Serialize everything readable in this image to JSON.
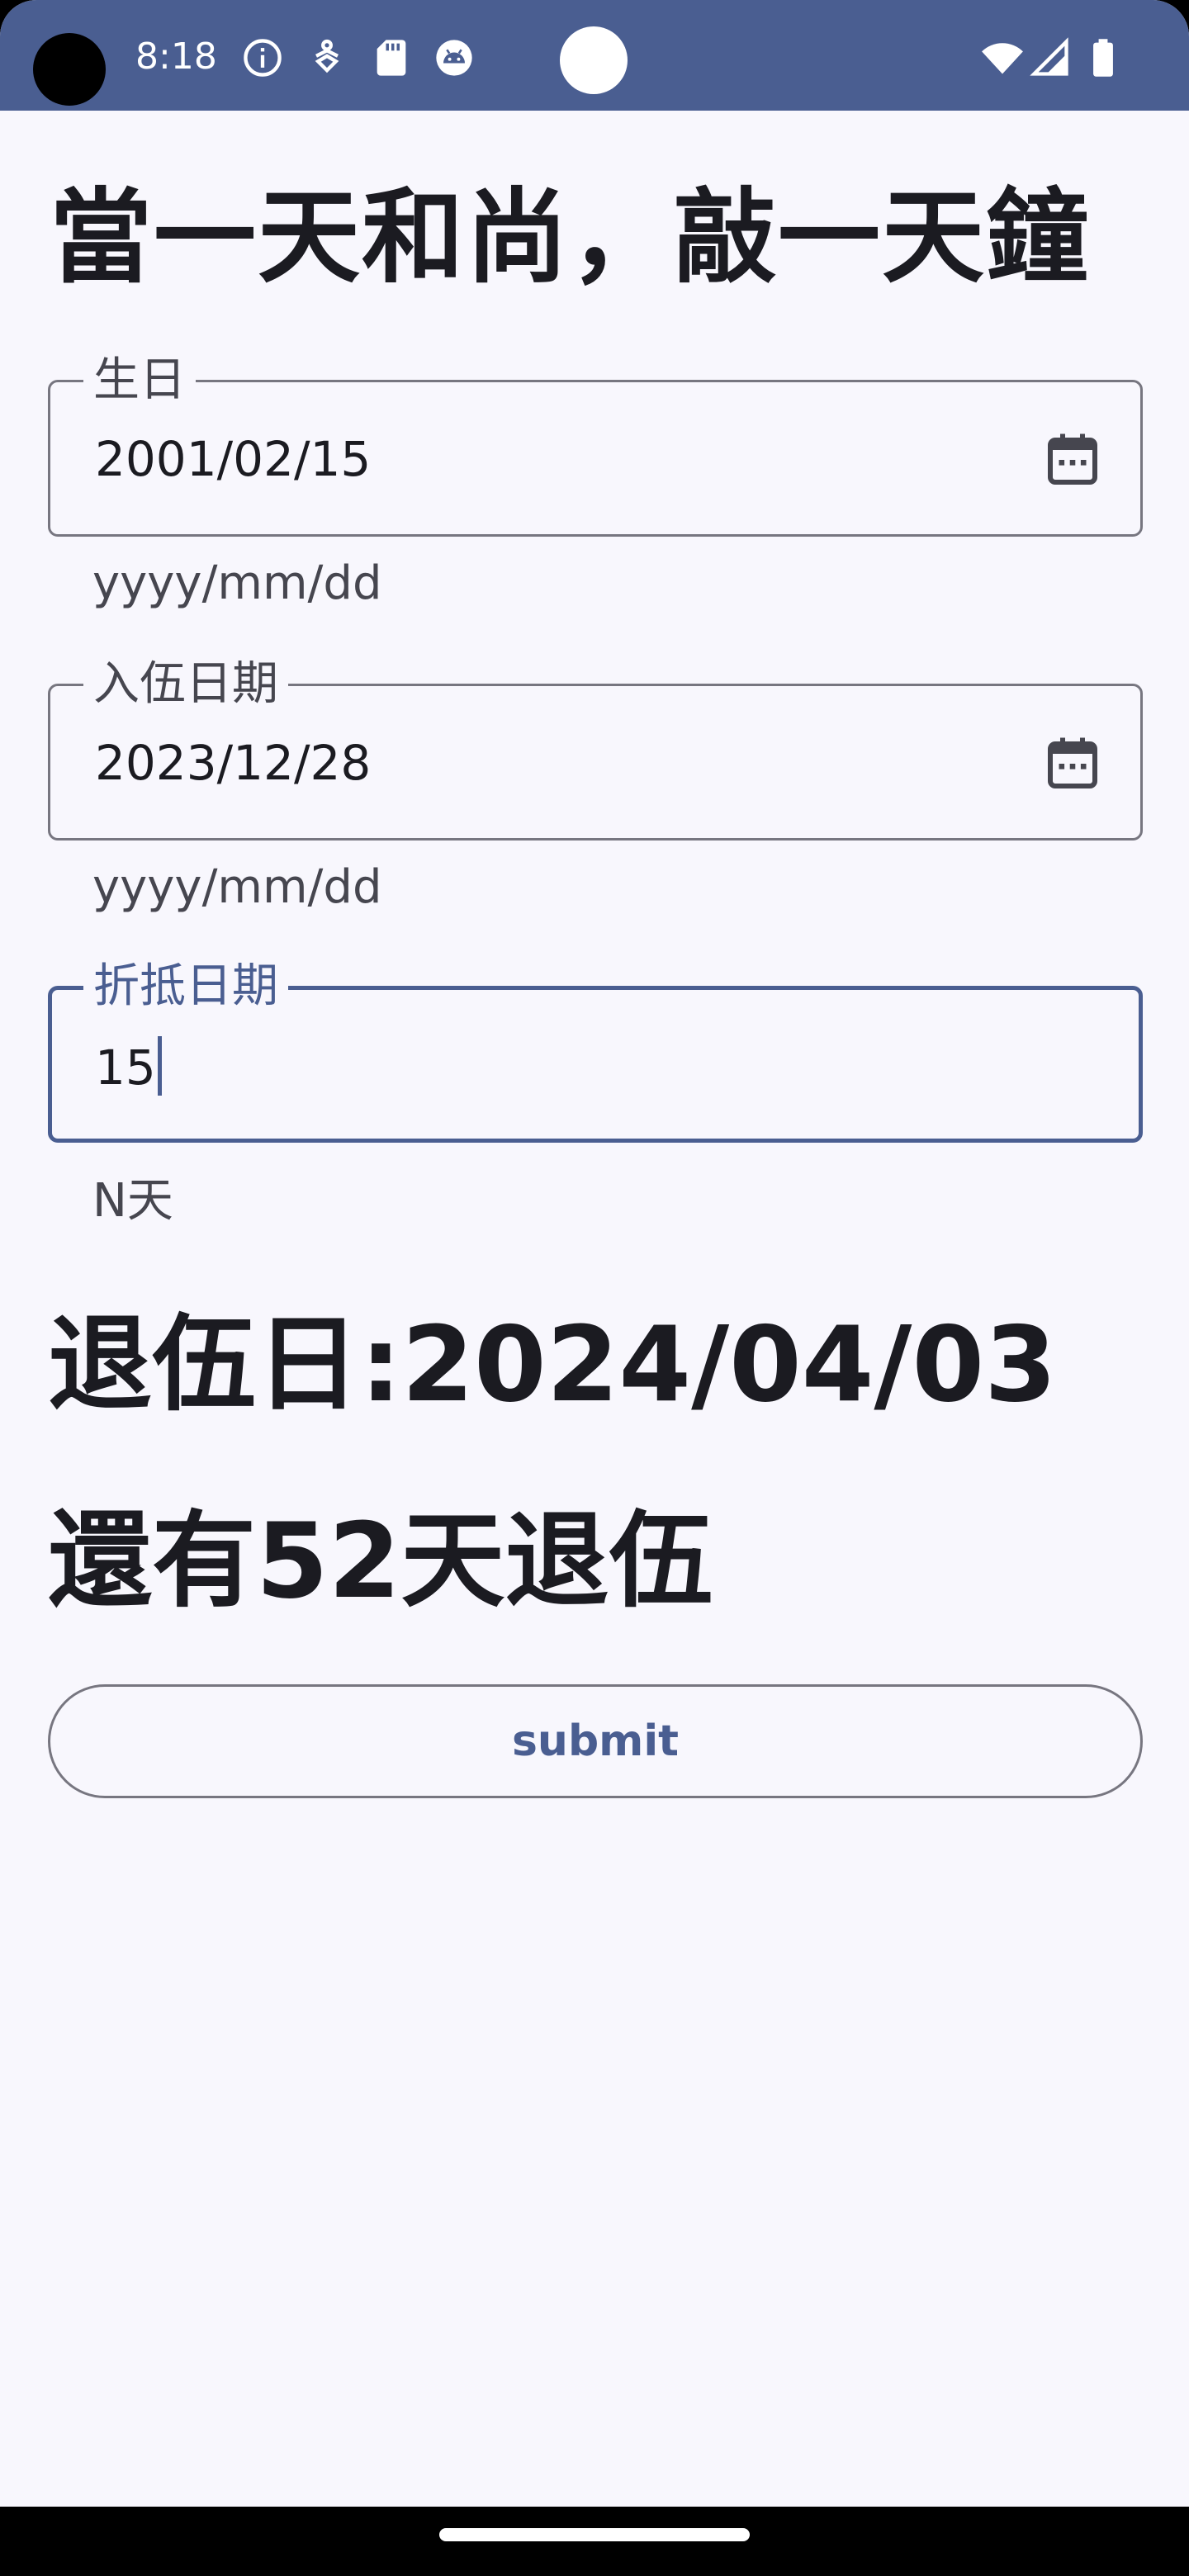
{
  "status_bar": {
    "time": "8:18",
    "icons": [
      "info-icon",
      "usb-debug-icon",
      "sd-card-icon",
      "android-icon",
      "wifi-icon",
      "signal-icon",
      "battery-icon"
    ],
    "background_color": "#4a5e91"
  },
  "page": {
    "title": "當一天和尚，敲一天鐘"
  },
  "fields": {
    "birthday": {
      "label": "生日",
      "value": "2001/02/15",
      "helper": "yyyy/mm/dd",
      "trailing_icon": "calendar-icon"
    },
    "enlist_date": {
      "label": "入伍日期",
      "value": "2023/12/28",
      "helper": "yyyy/mm/dd",
      "trailing_icon": "calendar-icon"
    },
    "deduction": {
      "label": "折抵日期",
      "value": "15",
      "helper": "N天",
      "focused": true
    }
  },
  "results": {
    "discharge_date": "退伍日:2024/04/03",
    "days_remaining": "還有52天退伍"
  },
  "submit": {
    "label": "submit"
  },
  "colors": {
    "primary": "#4a5e91",
    "background": "#f8f7fd",
    "text": "#1b1b21",
    "outline": "#777680"
  }
}
